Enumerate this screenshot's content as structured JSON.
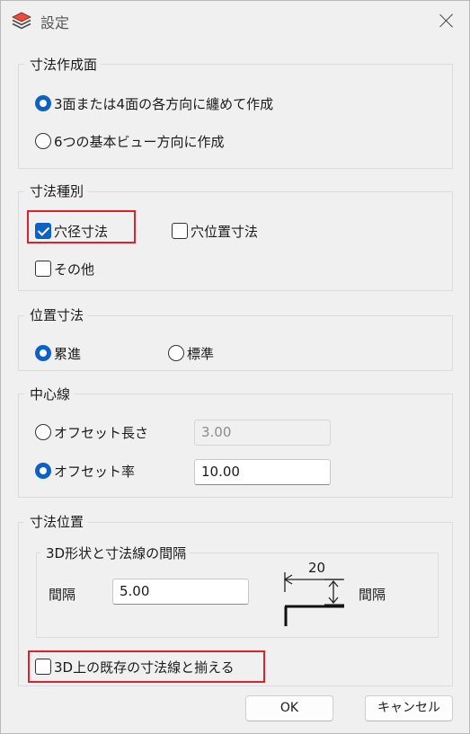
{
  "window": {
    "title": "設定",
    "app_icon": "layers-icon",
    "close_icon": "close-icon"
  },
  "dimension_creation": {
    "label": "寸法作成面",
    "options": [
      {
        "label": "3面または4面の各方向に纏めて作成",
        "selected": true
      },
      {
        "label": "6つの基本ビュー方向に作成",
        "selected": false
      }
    ]
  },
  "dimension_type": {
    "label": "寸法種別",
    "options": [
      {
        "label": "穴径寸法",
        "checked": true
      },
      {
        "label": "穴位置寸法",
        "checked": false
      },
      {
        "label": "その他",
        "checked": false
      }
    ]
  },
  "position_dimension": {
    "label": "位置寸法",
    "options": [
      {
        "label": "累進",
        "selected": true
      },
      {
        "label": "標準",
        "selected": false
      }
    ]
  },
  "center_line": {
    "label": "中心線",
    "offset_length": {
      "label": "オフセット長さ",
      "selected": false,
      "value": "3.00"
    },
    "offset_rate": {
      "label": "オフセット率",
      "selected": true,
      "value": "10.00"
    }
  },
  "dimension_position": {
    "label": "寸法位置",
    "spacing_group_label": "3D形状と寸法線の間隔",
    "spacing_label": "間隔",
    "spacing_value": "5.00",
    "diagram": {
      "number": "20",
      "label": "間隔"
    },
    "align_existing": {
      "label": "3D上の既存の寸法線と揃える",
      "checked": false
    }
  },
  "buttons": {
    "ok": "OK",
    "cancel": "キャンセル"
  },
  "colors": {
    "accent": "#0b61c6",
    "highlight": "#e0202a"
  }
}
